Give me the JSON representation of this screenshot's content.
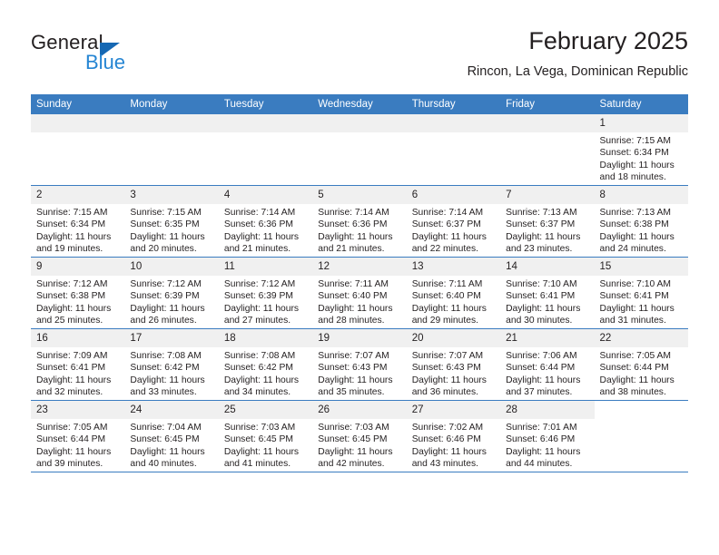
{
  "brand": {
    "name_top": "General",
    "name_bottom": "Blue",
    "triangle_color": "#1668b3",
    "blue_color": "#2585d3"
  },
  "header": {
    "title": "February 2025",
    "subtitle": "Rincon, La Vega, Dominican Republic"
  },
  "calendar": {
    "header_bg": "#3a7cc0",
    "daynum_bg": "#f0f0f0",
    "weekdays": [
      "Sunday",
      "Monday",
      "Tuesday",
      "Wednesday",
      "Thursday",
      "Friday",
      "Saturday"
    ],
    "weeks": [
      [
        {
          "day": "",
          "blank": true,
          "lines": []
        },
        {
          "day": "",
          "blank": true,
          "lines": []
        },
        {
          "day": "",
          "blank": true,
          "lines": []
        },
        {
          "day": "",
          "blank": true,
          "lines": []
        },
        {
          "day": "",
          "blank": true,
          "lines": []
        },
        {
          "day": "",
          "blank": true,
          "lines": []
        },
        {
          "day": "1",
          "lines": [
            "Sunrise: 7:15 AM",
            "Sunset: 6:34 PM",
            "Daylight: 11 hours",
            "and 18 minutes."
          ]
        }
      ],
      [
        {
          "day": "2",
          "lines": [
            "Sunrise: 7:15 AM",
            "Sunset: 6:34 PM",
            "Daylight: 11 hours",
            "and 19 minutes."
          ]
        },
        {
          "day": "3",
          "lines": [
            "Sunrise: 7:15 AM",
            "Sunset: 6:35 PM",
            "Daylight: 11 hours",
            "and 20 minutes."
          ]
        },
        {
          "day": "4",
          "lines": [
            "Sunrise: 7:14 AM",
            "Sunset: 6:36 PM",
            "Daylight: 11 hours",
            "and 21 minutes."
          ]
        },
        {
          "day": "5",
          "lines": [
            "Sunrise: 7:14 AM",
            "Sunset: 6:36 PM",
            "Daylight: 11 hours",
            "and 21 minutes."
          ]
        },
        {
          "day": "6",
          "lines": [
            "Sunrise: 7:14 AM",
            "Sunset: 6:37 PM",
            "Daylight: 11 hours",
            "and 22 minutes."
          ]
        },
        {
          "day": "7",
          "lines": [
            "Sunrise: 7:13 AM",
            "Sunset: 6:37 PM",
            "Daylight: 11 hours",
            "and 23 minutes."
          ]
        },
        {
          "day": "8",
          "lines": [
            "Sunrise: 7:13 AM",
            "Sunset: 6:38 PM",
            "Daylight: 11 hours",
            "and 24 minutes."
          ]
        }
      ],
      [
        {
          "day": "9",
          "lines": [
            "Sunrise: 7:12 AM",
            "Sunset: 6:38 PM",
            "Daylight: 11 hours",
            "and 25 minutes."
          ]
        },
        {
          "day": "10",
          "lines": [
            "Sunrise: 7:12 AM",
            "Sunset: 6:39 PM",
            "Daylight: 11 hours",
            "and 26 minutes."
          ]
        },
        {
          "day": "11",
          "lines": [
            "Sunrise: 7:12 AM",
            "Sunset: 6:39 PM",
            "Daylight: 11 hours",
            "and 27 minutes."
          ]
        },
        {
          "day": "12",
          "lines": [
            "Sunrise: 7:11 AM",
            "Sunset: 6:40 PM",
            "Daylight: 11 hours",
            "and 28 minutes."
          ]
        },
        {
          "day": "13",
          "lines": [
            "Sunrise: 7:11 AM",
            "Sunset: 6:40 PM",
            "Daylight: 11 hours",
            "and 29 minutes."
          ]
        },
        {
          "day": "14",
          "lines": [
            "Sunrise: 7:10 AM",
            "Sunset: 6:41 PM",
            "Daylight: 11 hours",
            "and 30 minutes."
          ]
        },
        {
          "day": "15",
          "lines": [
            "Sunrise: 7:10 AM",
            "Sunset: 6:41 PM",
            "Daylight: 11 hours",
            "and 31 minutes."
          ]
        }
      ],
      [
        {
          "day": "16",
          "lines": [
            "Sunrise: 7:09 AM",
            "Sunset: 6:41 PM",
            "Daylight: 11 hours",
            "and 32 minutes."
          ]
        },
        {
          "day": "17",
          "lines": [
            "Sunrise: 7:08 AM",
            "Sunset: 6:42 PM",
            "Daylight: 11 hours",
            "and 33 minutes."
          ]
        },
        {
          "day": "18",
          "lines": [
            "Sunrise: 7:08 AM",
            "Sunset: 6:42 PM",
            "Daylight: 11 hours",
            "and 34 minutes."
          ]
        },
        {
          "day": "19",
          "lines": [
            "Sunrise: 7:07 AM",
            "Sunset: 6:43 PM",
            "Daylight: 11 hours",
            "and 35 minutes."
          ]
        },
        {
          "day": "20",
          "lines": [
            "Sunrise: 7:07 AM",
            "Sunset: 6:43 PM",
            "Daylight: 11 hours",
            "and 36 minutes."
          ]
        },
        {
          "day": "21",
          "lines": [
            "Sunrise: 7:06 AM",
            "Sunset: 6:44 PM",
            "Daylight: 11 hours",
            "and 37 minutes."
          ]
        },
        {
          "day": "22",
          "lines": [
            "Sunrise: 7:05 AM",
            "Sunset: 6:44 PM",
            "Daylight: 11 hours",
            "and 38 minutes."
          ]
        }
      ],
      [
        {
          "day": "23",
          "lines": [
            "Sunrise: 7:05 AM",
            "Sunset: 6:44 PM",
            "Daylight: 11 hours",
            "and 39 minutes."
          ]
        },
        {
          "day": "24",
          "lines": [
            "Sunrise: 7:04 AM",
            "Sunset: 6:45 PM",
            "Daylight: 11 hours",
            "and 40 minutes."
          ]
        },
        {
          "day": "25",
          "lines": [
            "Sunrise: 7:03 AM",
            "Sunset: 6:45 PM",
            "Daylight: 11 hours",
            "and 41 minutes."
          ]
        },
        {
          "day": "26",
          "lines": [
            "Sunrise: 7:03 AM",
            "Sunset: 6:45 PM",
            "Daylight: 11 hours",
            "and 42 minutes."
          ]
        },
        {
          "day": "27",
          "lines": [
            "Sunrise: 7:02 AM",
            "Sunset: 6:46 PM",
            "Daylight: 11 hours",
            "and 43 minutes."
          ]
        },
        {
          "day": "28",
          "lines": [
            "Sunrise: 7:01 AM",
            "Sunset: 6:46 PM",
            "Daylight: 11 hours",
            "and 44 minutes."
          ]
        },
        {
          "day": "",
          "blank": true,
          "nofill": true,
          "lines": []
        }
      ]
    ]
  }
}
